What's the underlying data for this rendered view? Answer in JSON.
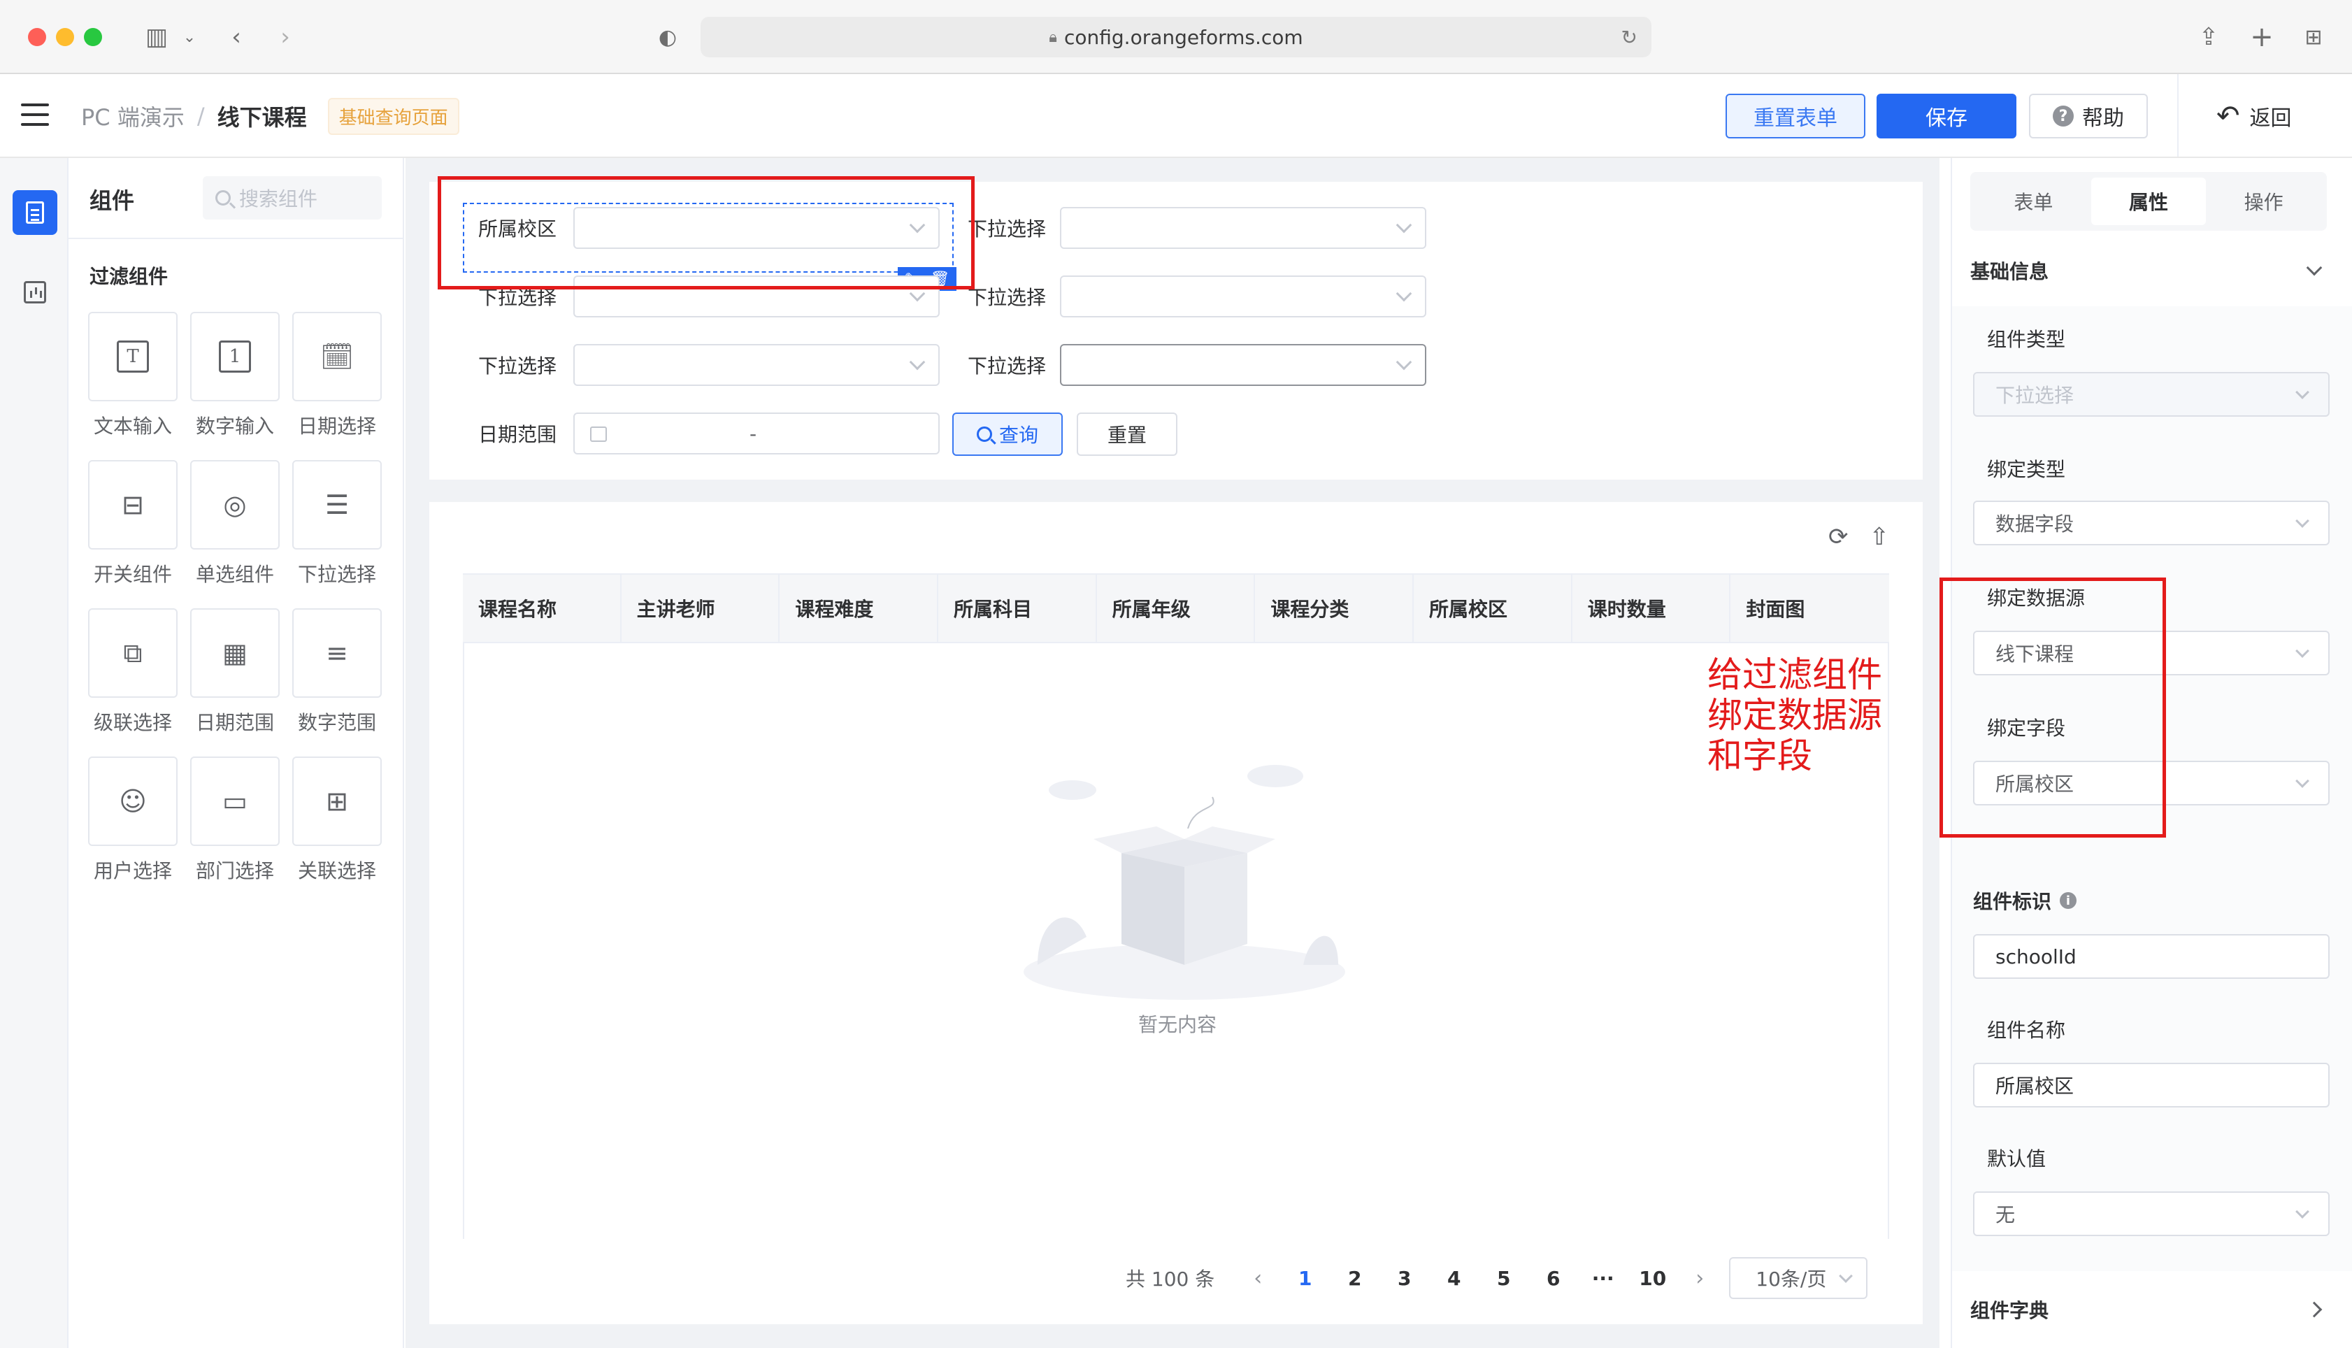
{
  "browser": {
    "url": "config.orangeforms.com"
  },
  "header": {
    "breadcrumb_root": "PC 端演示",
    "breadcrumb_sep": "/",
    "breadcrumb_current": "线下课程",
    "page_tag": "基础查询页面",
    "reset_form_label": "重置表单",
    "save_label": "保存",
    "help_label": "帮助",
    "back_label": "返回"
  },
  "components": {
    "title": "组件",
    "search_placeholder": "搜索组件",
    "group_title": "过滤组件",
    "items": [
      {
        "label": "文本输入",
        "icon": "text-input-icon",
        "glyph": "T"
      },
      {
        "label": "数字输入",
        "icon": "number-input-icon",
        "glyph": "1"
      },
      {
        "label": "日期选择",
        "icon": "date-picker-icon",
        "glyph": "📅"
      },
      {
        "label": "开关组件",
        "icon": "switch-icon",
        "glyph": "⊟"
      },
      {
        "label": "单选组件",
        "icon": "radio-icon",
        "glyph": "◎"
      },
      {
        "label": "下拉选择",
        "icon": "dropdown-icon",
        "glyph": "☰"
      },
      {
        "label": "级联选择",
        "icon": "cascader-icon",
        "glyph": "⧉"
      },
      {
        "label": "日期范围",
        "icon": "date-range-icon",
        "glyph": "▦"
      },
      {
        "label": "数字范围",
        "icon": "number-range-icon",
        "glyph": "≡"
      },
      {
        "label": "用户选择",
        "icon": "user-select-icon",
        "glyph": "☺"
      },
      {
        "label": "部门选择",
        "icon": "dept-select-icon",
        "glyph": "▭"
      },
      {
        "label": "关联选择",
        "icon": "relation-select-icon",
        "glyph": "⊞"
      }
    ]
  },
  "filters": {
    "selected_label": "所属校区",
    "dropdown_label": "下拉选择",
    "date_range_label": "日期范围",
    "date_range_sep": "-",
    "query_label": "查询",
    "reset_label": "重置"
  },
  "table": {
    "columns": [
      "课程名称",
      "主讲老师",
      "课程难度",
      "所属科目",
      "所属年级",
      "课程分类",
      "所属校区",
      "课时数量",
      "封面图"
    ],
    "empty_text": "暂无内容"
  },
  "annotation": {
    "lines": [
      "给过滤组件",
      "绑定数据源",
      "和字段"
    ]
  },
  "pagination": {
    "total_text": "共 100 条",
    "pages": [
      "1",
      "2",
      "3",
      "4",
      "5",
      "6",
      "···",
      "10"
    ],
    "current_page": "1",
    "page_size": "10条/页"
  },
  "properties": {
    "tabs": [
      "表单",
      "属性",
      "操作"
    ],
    "active_tab": "属性",
    "section_basic": "基础信息",
    "component_type_label": "组件类型",
    "component_type_value": "下拉选择",
    "bind_type_label": "绑定类型",
    "bind_type_value": "数据字段",
    "bind_datasource_label": "绑定数据源",
    "bind_datasource_value": "线下课程",
    "bind_field_label": "绑定字段",
    "bind_field_value": "所属校区",
    "component_id_label": "组件标识",
    "component_id_value": "schoolId",
    "component_name_label": "组件名称",
    "component_name_value": "所属校区",
    "default_value_label": "默认值",
    "default_value_value": "无",
    "section_dict": "组件字典"
  },
  "colors": {
    "primary": "#2468f2",
    "annotation_red": "#e31b1b",
    "tag_orange": "#e6a23c"
  }
}
